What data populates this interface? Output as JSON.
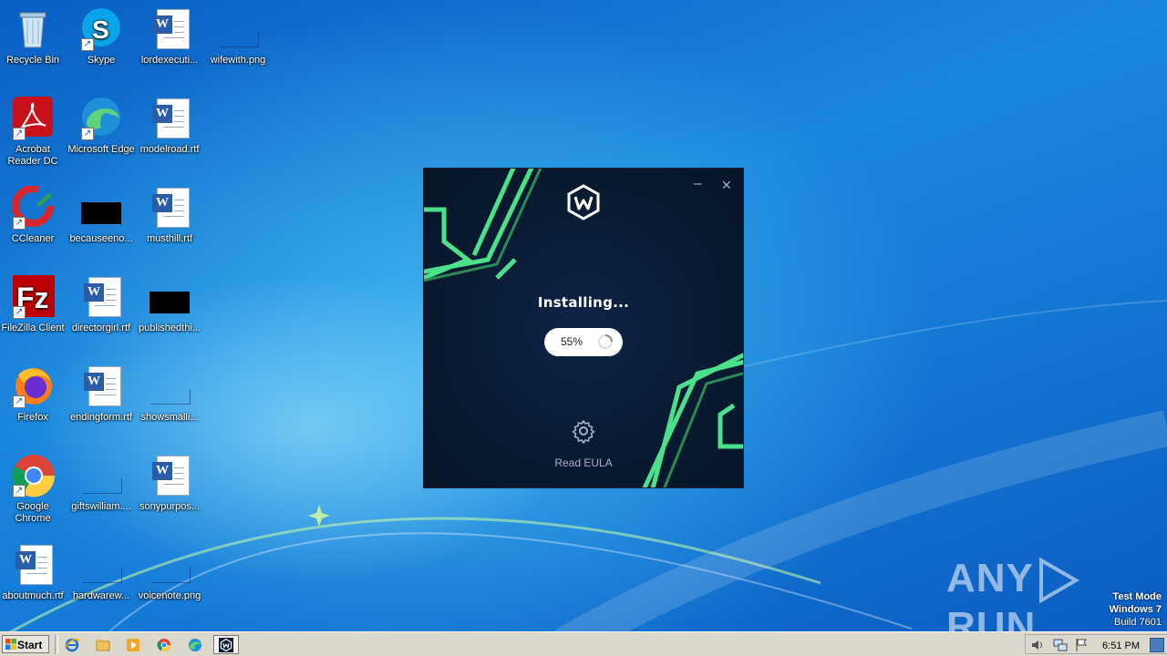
{
  "desktop": {
    "icons": [
      {
        "label": "Recycle Bin",
        "icon": "recycle-bin-icon"
      },
      {
        "label": "Skype",
        "icon": "skype-icon"
      },
      {
        "label": "lordexecuti...",
        "icon": "word-document-icon"
      },
      {
        "label": "wifewith.png",
        "icon": "image-file-icon"
      },
      {
        "label": "Acrobat Reader DC",
        "icon": "acrobat-reader-icon"
      },
      {
        "label": "Microsoft Edge",
        "icon": "edge-icon"
      },
      {
        "label": "modelroad.rtf",
        "icon": "word-document-icon"
      },
      {
        "label": "CCleaner",
        "icon": "ccleaner-icon"
      },
      {
        "label": "becauseeno...",
        "icon": "black-file-icon"
      },
      {
        "label": "musthill.rtf",
        "icon": "word-document-icon"
      },
      {
        "label": "FileZilla Client",
        "icon": "filezilla-icon"
      },
      {
        "label": "directorgirl.rtf",
        "icon": "word-document-icon"
      },
      {
        "label": "publishedthi...",
        "icon": "black-file-icon"
      },
      {
        "label": "Firefox",
        "icon": "firefox-icon"
      },
      {
        "label": "endingform.rtf",
        "icon": "word-document-icon"
      },
      {
        "label": "showsmalli...",
        "icon": "image-file-icon"
      },
      {
        "label": "Google Chrome",
        "icon": "chrome-icon"
      },
      {
        "label": "giftswilliam....",
        "icon": "image-file-icon"
      },
      {
        "label": "sonypurpos...",
        "icon": "word-document-icon"
      },
      {
        "label": "aboutmuch.rtf",
        "icon": "word-document-icon"
      },
      {
        "label": "hardwarew...",
        "icon": "image-file-icon"
      },
      {
        "label": "voicenote.png",
        "icon": "image-file-icon"
      }
    ]
  },
  "installer": {
    "title": "Installing...",
    "progress_percent": 55,
    "progress_label": "55%",
    "eula_label": "Read EULA",
    "minimize_glyph": "–",
    "close_glyph": "✕",
    "accent_color": "#4be08a"
  },
  "watermark": {
    "brand_left": "ANY",
    "brand_right": "RUN",
    "test_mode": "Test Mode",
    "os": "Windows 7",
    "build": "Build 7601"
  },
  "taskbar": {
    "start_label": "Start",
    "clock": "6:51 PM",
    "pinned": [
      "internet-explorer-icon",
      "explorer-icon",
      "media-player-icon",
      "chrome-icon",
      "edge-icon",
      "installer-icon"
    ]
  }
}
